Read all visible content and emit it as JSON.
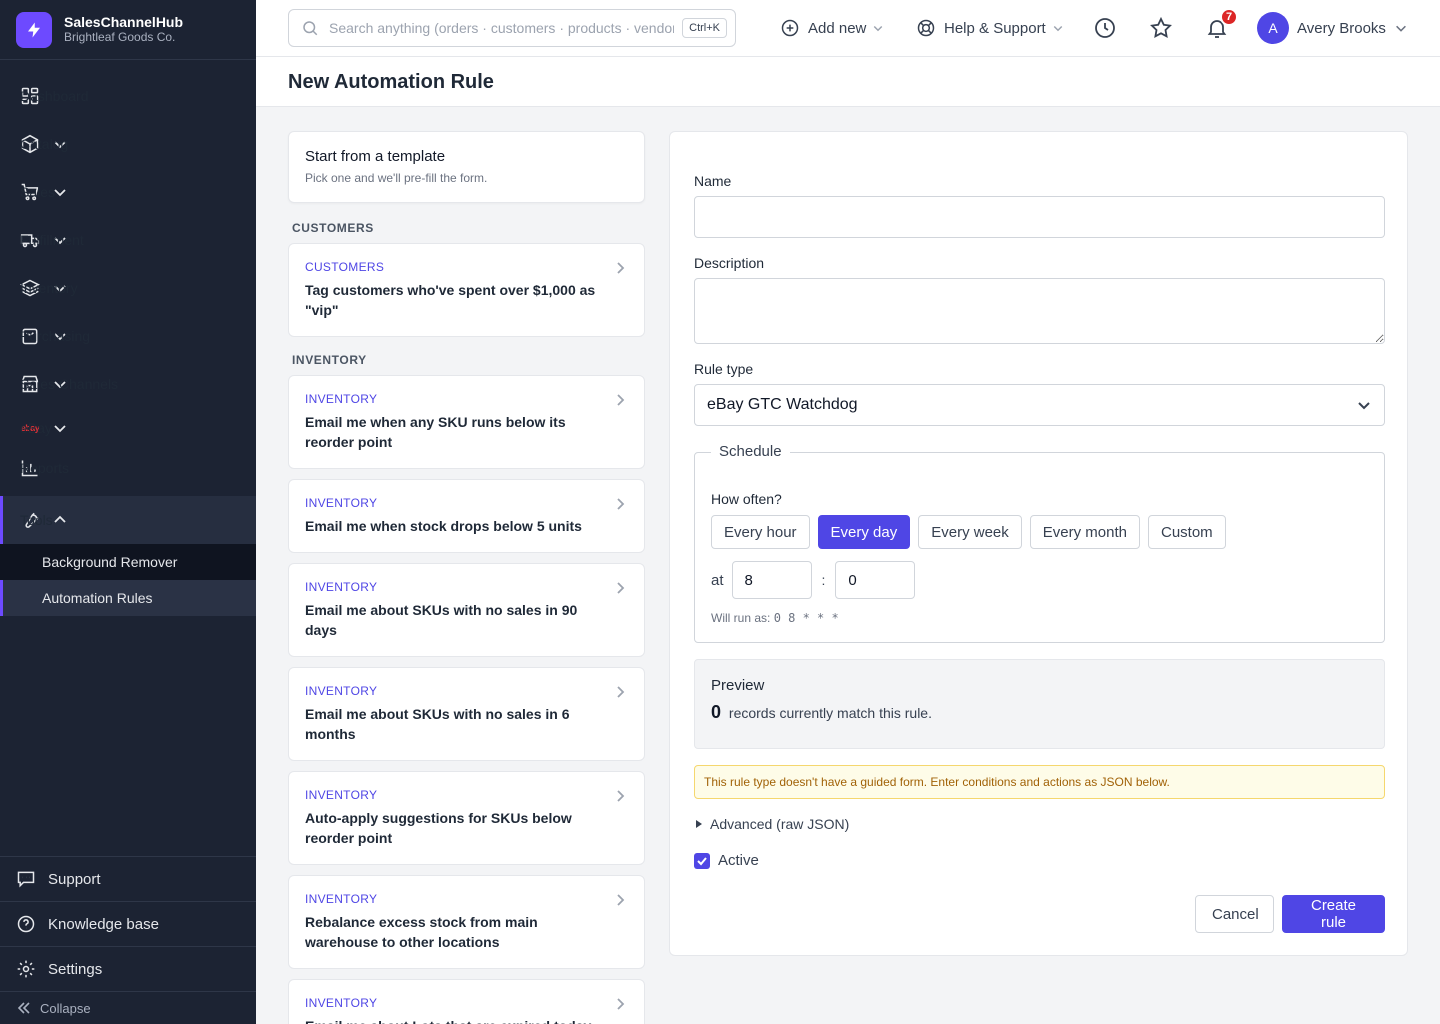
{
  "brand": {
    "name": "SalesChannelHub",
    "org": "Brightleaf Goods Co."
  },
  "nav": {
    "dashboard": "Dashboard",
    "catalog": "Catalog",
    "sales": "Sales",
    "fulfillment": "Fulfillment",
    "inventory": "Inventory",
    "purchasing": "Purchasing",
    "sales_channels": "Sales Channels",
    "ebay": "eBay",
    "ebay_mark": "ebay",
    "reports": "Reports",
    "tools": "Tools",
    "tools_sub": [
      "Background Remover",
      "Automation Rules"
    ]
  },
  "sidebar_bottom": {
    "support": "Support",
    "knowledge_base": "Knowledge base",
    "settings": "Settings",
    "collapse": "Collapse"
  },
  "topbar": {
    "search_placeholder": "Search anything (orders · customers · products · vendors)",
    "search_shortcut": "Ctrl+K",
    "add_new": "Add new",
    "help": "Help & Support",
    "notifications_count": "7",
    "user_initial": "A",
    "user_name": "Avery Brooks"
  },
  "page": {
    "title": "New Automation Rule"
  },
  "templates": {
    "header_title": "Start from a template",
    "header_sub": "Pick one and we'll pre-fill the form.",
    "groups": [
      {
        "label": "CUSTOMERS",
        "items": [
          {
            "category": "CUSTOMERS",
            "text": "Tag customers who've spent over $1,000 as \"vip\""
          }
        ]
      },
      {
        "label": "INVENTORY",
        "items": [
          {
            "category": "INVENTORY",
            "text": "Email me when any SKU runs below its reorder point"
          },
          {
            "category": "INVENTORY",
            "text": "Email me when stock drops below 5 units"
          },
          {
            "category": "INVENTORY",
            "text": "Email me about SKUs with no sales in 90 days"
          },
          {
            "category": "INVENTORY",
            "text": "Email me about SKUs with no sales in 6 months"
          },
          {
            "category": "INVENTORY",
            "text": "Auto-apply suggestions for SKUs below reorder point"
          },
          {
            "category": "INVENTORY",
            "text": "Rebalance excess stock from main warehouse to other locations"
          },
          {
            "category": "INVENTORY",
            "text": "Email me about Lots that are expired today"
          }
        ]
      }
    ]
  },
  "form": {
    "name_label": "Name",
    "name_value": "",
    "description_label": "Description",
    "description_value": "",
    "rule_type_label": "Rule type",
    "rule_type_value": "eBay GTC Watchdog",
    "schedule_legend": "Schedule",
    "how_often_label": "How often?",
    "frequency_options": [
      "Every hour",
      "Every day",
      "Every week",
      "Every month",
      "Custom"
    ],
    "frequency_selected": "Every day",
    "at_label": "at",
    "hour": "8",
    "colon": ":",
    "minute": "0",
    "will_run_label": "Will run as:",
    "cron": "0 8 * * *",
    "preview_title": "Preview",
    "preview_count": "0",
    "preview_text": "records currently match this rule.",
    "warning": "This rule type doesn't have a guided form. Enter conditions and actions as JSON below.",
    "advanced_label": "Advanced (raw JSON)",
    "active_label": "Active",
    "active_checked": true,
    "cancel_label": "Cancel",
    "create_label": "Create rule"
  },
  "colors": {
    "accent": "#4f46e5",
    "sidebar_bg": "#1c2333",
    "brand": "#6d4aff",
    "badge": "#dc2626"
  }
}
